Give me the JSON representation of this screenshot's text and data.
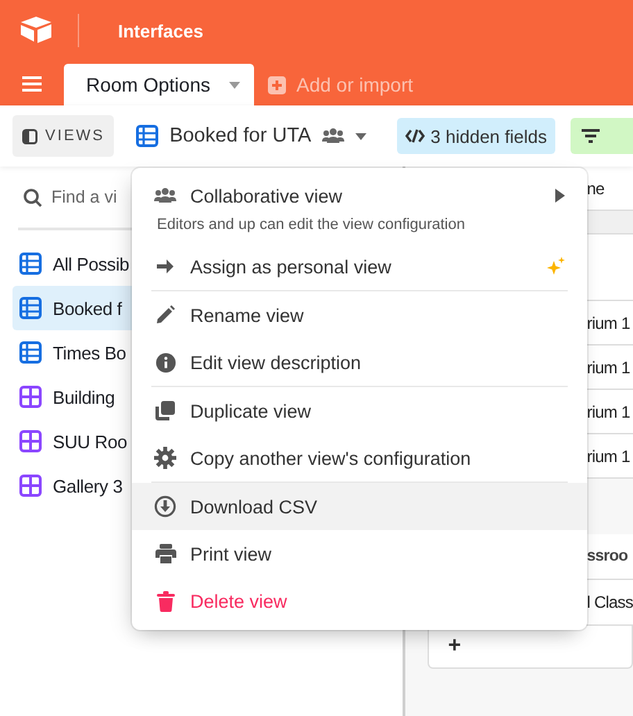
{
  "header": {
    "title": "Interfaces"
  },
  "tabs": [
    {
      "label": "Room Options",
      "selected": true
    }
  ],
  "add_button": {
    "label": "Add or import"
  },
  "toolbar": {
    "views_button": "VIEWS",
    "current_view": "Booked for UTA",
    "hidden_fields": "3 hidden fields"
  },
  "sidebar": {
    "search": {
      "placeholder": "Find a vi"
    },
    "items": [
      {
        "label": "All Possib",
        "kind": "grid",
        "selected": false
      },
      {
        "label": "Booked f",
        "kind": "grid",
        "selected": true
      },
      {
        "label": "Times Bo",
        "kind": "grid",
        "selected": false
      },
      {
        "label": "Building",
        "kind": "gallery",
        "selected": false
      },
      {
        "label": "SUU Roo",
        "kind": "gallery",
        "selected": false
      },
      {
        "label": "Gallery 3",
        "kind": "gallery",
        "selected": false
      }
    ]
  },
  "grid": {
    "header": "ne",
    "rows": [
      "rium 1",
      "rium 1",
      "rium 1",
      "rium 1"
    ],
    "group_rows": [
      "ssroo",
      "l Class"
    ],
    "add": "+"
  },
  "menu": {
    "sections": [
      [
        {
          "label": "Collaborative view",
          "subtitle": "Editors and up can edit the view configuration",
          "submenu": true,
          "kind": "normal",
          "highlighted": false
        },
        {
          "label": "Assign as personal view",
          "submenu": false,
          "kind": "normal",
          "highlighted": false
        }
      ],
      [
        {
          "label": "Rename view",
          "submenu": false,
          "kind": "normal",
          "highlighted": false
        },
        {
          "label": "Edit view description",
          "submenu": false,
          "kind": "normal",
          "highlighted": false
        }
      ],
      [
        {
          "label": "Duplicate view",
          "submenu": false,
          "kind": "normal",
          "highlighted": false
        },
        {
          "label": "Copy another view's configuration",
          "submenu": false,
          "kind": "normal",
          "highlighted": false
        }
      ],
      [
        {
          "label": "Download CSV",
          "submenu": false,
          "kind": "normal",
          "highlighted": true
        },
        {
          "label": "Print view",
          "submenu": false,
          "kind": "normal",
          "highlighted": false
        },
        {
          "label": "Delete view",
          "submenu": false,
          "kind": "danger",
          "highlighted": false
        }
      ]
    ]
  }
}
